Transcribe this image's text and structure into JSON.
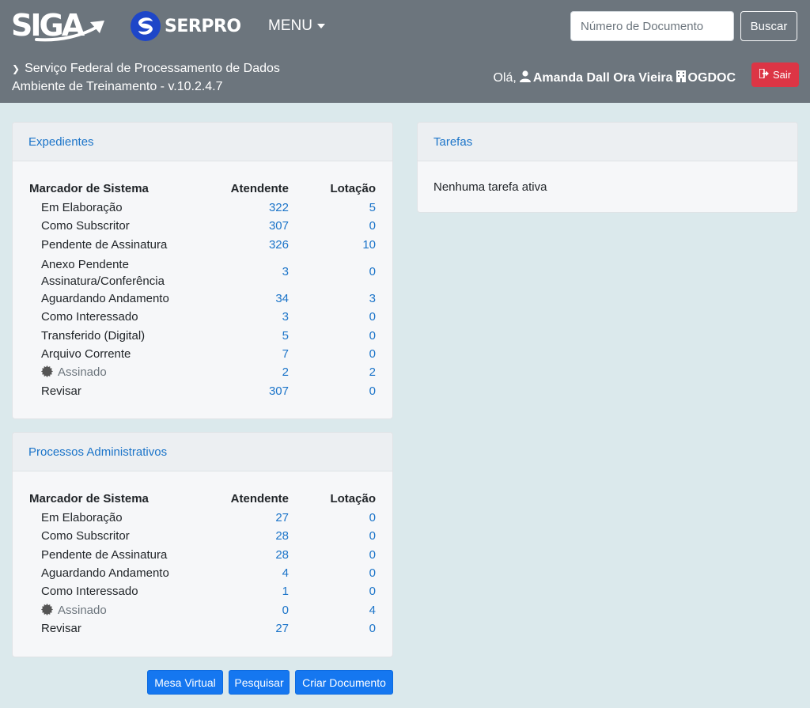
{
  "header": {
    "logo_siga": "SIGA",
    "logo_serpro": "SERPRO",
    "menu_label": "MENU",
    "search_placeholder": "Número de Documento",
    "search_button": "Buscar",
    "org_name": "Serviço Federal de Processamento de Dados",
    "environment": "Ambiente de Treinamento - v.10.2.4.7",
    "greeting": "Olá,",
    "user_name": "Amanda Dall Ora Vieira",
    "unit": "OGDOC",
    "logout_label": "Sair"
  },
  "expedientes": {
    "title": "Expedientes",
    "col_marker": "Marcador de Sistema",
    "col_attendant": "Atendente",
    "col_lotacao": "Lotação",
    "rows": [
      {
        "label": "Em Elaboração",
        "atendente": "322",
        "lotacao": "5"
      },
      {
        "label": "Como Subscritor",
        "atendente": "307",
        "lotacao": "0"
      },
      {
        "label": "Pendente de Assinatura",
        "atendente": "326",
        "lotacao": "10"
      },
      {
        "label": "Anexo Pendente Assinatura/Conferência",
        "atendente": "3",
        "lotacao": "0"
      },
      {
        "label": "Aguardando Andamento",
        "atendente": "34",
        "lotacao": "3"
      },
      {
        "label": "Como Interessado",
        "atendente": "3",
        "lotacao": "0"
      },
      {
        "label": "Transferido (Digital)",
        "atendente": "5",
        "lotacao": "0"
      },
      {
        "label": "Arquivo Corrente",
        "atendente": "7",
        "lotacao": "0"
      },
      {
        "label": "Assinado",
        "atendente": "2",
        "lotacao": "2",
        "icon": "seal-icon"
      },
      {
        "label": "Revisar",
        "atendente": "307",
        "lotacao": "0"
      }
    ]
  },
  "processos": {
    "title": "Processos Administrativos",
    "col_marker": "Marcador de Sistema",
    "col_attendant": "Atendente",
    "col_lotacao": "Lotação",
    "rows": [
      {
        "label": "Em Elaboração",
        "atendente": "27",
        "lotacao": "0"
      },
      {
        "label": "Como Subscritor",
        "atendente": "28",
        "lotacao": "0"
      },
      {
        "label": "Pendente de Assinatura",
        "atendente": "28",
        "lotacao": "0"
      },
      {
        "label": "Aguardando Andamento",
        "atendente": "4",
        "lotacao": "0"
      },
      {
        "label": "Como Interessado",
        "atendente": "1",
        "lotacao": "0"
      },
      {
        "label": "Assinado",
        "atendente": "0",
        "lotacao": "4",
        "icon": "seal-icon"
      },
      {
        "label": "Revisar",
        "atendente": "27",
        "lotacao": "0"
      }
    ]
  },
  "tarefas": {
    "title": "Tarefas",
    "empty_message": "Nenhuma tarefa ativa"
  },
  "actions": {
    "mesa_virtual": "Mesa Virtual",
    "pesquisar": "Pesquisar",
    "criar_documento": "Criar Documento"
  },
  "colors": {
    "header_bg": "#6c757d",
    "page_bg": "#dbe9ec",
    "link": "#1b74c9",
    "primary": "#1577f0",
    "danger": "#dc3545"
  }
}
